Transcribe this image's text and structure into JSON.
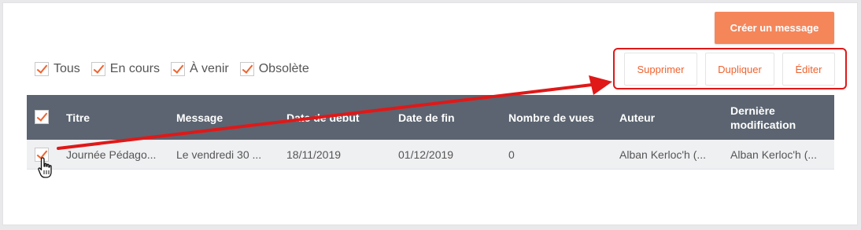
{
  "toolbar": {
    "create_label": "Créer un message"
  },
  "filters": [
    {
      "label": "Tous",
      "checked": true
    },
    {
      "label": "En cours",
      "checked": true
    },
    {
      "label": "À venir",
      "checked": true
    },
    {
      "label": "Obsolète",
      "checked": true
    }
  ],
  "actions": {
    "delete_label": "Supprimer",
    "duplicate_label": "Dupliquer",
    "edit_label": "Éditer"
  },
  "table": {
    "headers": {
      "title": "Titre",
      "message": "Message",
      "start": "Date de début",
      "end": "Date de fin",
      "views": "Nombre de vues",
      "author": "Auteur",
      "modified_line1": "Dernière",
      "modified_line2": "modification"
    },
    "rows": [
      {
        "checked": true,
        "title": "Journée Pédago...",
        "message": "Le vendredi 30 ...",
        "start": "18/11/2019",
        "end": "01/12/2019",
        "views": "0",
        "author": "Alban Kerloc'h (...",
        "modified": "Alban Kerloc'h (..."
      }
    ]
  },
  "colors": {
    "accent": "#f5865a",
    "header_bg": "#5b6470",
    "annotation_red": "#e01818"
  },
  "icons": {
    "cursor": "hand-pointer-icon",
    "checkbox": "checkmark-icon"
  }
}
